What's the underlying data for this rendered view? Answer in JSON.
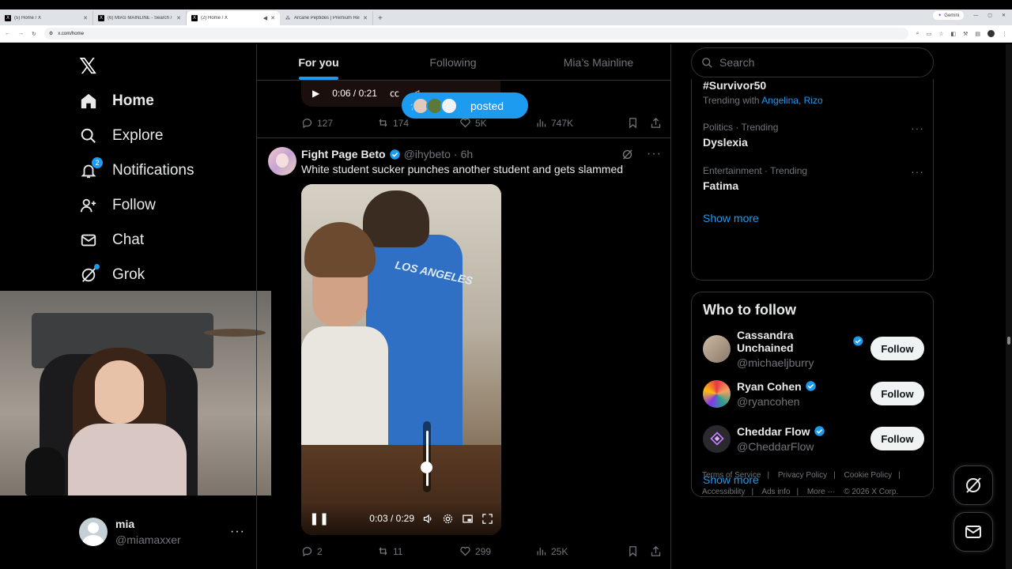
{
  "browser": {
    "tabs": [
      {
        "title": "(5) Home / X",
        "icon": "x-logo-icon",
        "active": false
      },
      {
        "title": "(6) MIAS MAINLINE - Search / X",
        "icon": "x-logo-icon",
        "active": false
      },
      {
        "title": "(2) Home / X",
        "icon": "x-logo-icon",
        "active": true
      },
      {
        "title": "Arcane Peptides | Premium Res...",
        "icon": "peptide-icon",
        "active": false
      }
    ],
    "gemini_label": "Gemini",
    "url": "x.com/home"
  },
  "nav": {
    "items": [
      {
        "label": "Home",
        "icon": "home-icon",
        "active": true
      },
      {
        "label": "Explore",
        "icon": "search-icon"
      },
      {
        "label": "Notifications",
        "icon": "bell-icon",
        "badge": "2"
      },
      {
        "label": "Follow",
        "icon": "person-add-icon"
      },
      {
        "label": "Chat",
        "icon": "mail-icon"
      },
      {
        "label": "Grok",
        "icon": "grok-icon"
      }
    ]
  },
  "account": {
    "name": "mia",
    "handle": "@miamaxxer",
    "more": "···"
  },
  "feed": {
    "tabs": [
      "For you",
      "Following",
      "Mia’s Mainline"
    ],
    "prev_video": {
      "time": "0:06 / 0:21"
    },
    "posted_pill": "posted",
    "prev_actions": {
      "replies": "127",
      "reposts": "174",
      "likes": "5K",
      "views": "747K"
    },
    "tweet": {
      "name": "Fight Page Beto",
      "handle": "@ihybeto",
      "dot": "·",
      "time": "6h",
      "text": "White student sucker punches another student and gets slammed",
      "video_time": "0:03 / 0:29",
      "video_shirt_text": "LOS ANGELES",
      "volume_level": 0.35,
      "actions": {
        "replies": "2",
        "reposts": "11",
        "likes": "299",
        "views": "25K"
      }
    }
  },
  "right": {
    "search_placeholder": "Search",
    "trends": [
      {
        "meta": "",
        "name": "#Survivor50",
        "with_label": "Trending with",
        "with_links": "Angelina, Rizo"
      },
      {
        "meta": "Politics · Trending",
        "name": "Dyslexia"
      },
      {
        "meta": "Entertainment · Trending",
        "name": "Fatima"
      }
    ],
    "trends_show_more": "Show more",
    "who_to_follow": {
      "title": "Who to follow",
      "users": [
        {
          "name": "Cassandra Unchained",
          "handle": "@michaeljburry",
          "button": "Follow"
        },
        {
          "name": "Ryan Cohen",
          "handle": "@ryancohen",
          "button": "Follow"
        },
        {
          "name": "Cheddar Flow",
          "handle": "@CheddarFlow",
          "button": "Follow"
        }
      ],
      "show_more": "Show more"
    },
    "footer": {
      "links": [
        "Terms of Service",
        "Privacy Policy",
        "Cookie Policy",
        "Accessibility",
        "Ads info",
        "More ···"
      ],
      "copyright": "© 2026 X Corp."
    }
  },
  "colors": {
    "accent": "#1d9bf0",
    "background": "#000000",
    "border": "#2f3336",
    "muted": "#71767b"
  }
}
